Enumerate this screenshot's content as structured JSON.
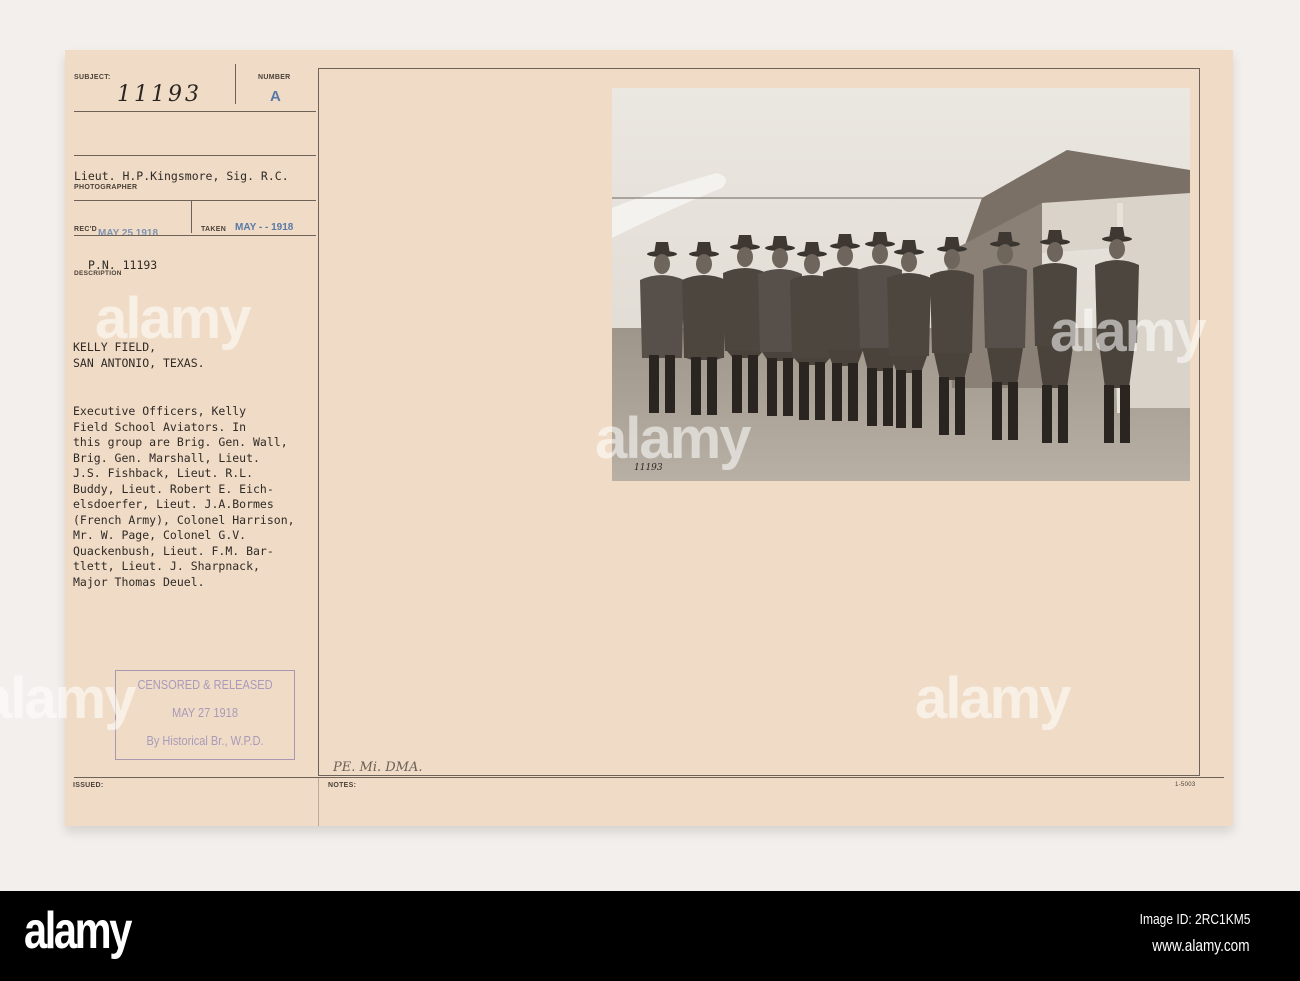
{
  "card": {
    "subject_label": "SUBJECT:",
    "subject_number": "11193",
    "number_label": "NUMBER",
    "number_value": "A",
    "photographer": "Lieut. H.P.Kingsmore, Sig. R.C.",
    "photographer_label": "PHOTOGRAPHER",
    "recd_label": "REC'D",
    "recd_date": "MAY 25 1918",
    "taken_label": "TAKEN",
    "taken_date": "MAY - - 1918",
    "pn": "P.N. 11193",
    "description_label": "DESCRIPTION",
    "location_line1": "KELLY FIELD,",
    "location_line2": "SAN ANTONIO, TEXAS.",
    "description_lines": [
      "Executive Officers, Kelly",
      "Field School Aviators. In",
      "this group are Brig. Gen. Wall,",
      "Brig. Gen. Marshall, Lieut.",
      "J.S. Fishback, Lieut. R.L.",
      "Buddy, Lieut. Robert E. Eich-",
      "elsdoerfer, Lieut. J.A.Bormes",
      "(French Army), Colonel Harrison,",
      "Mr. W. Page, Colonel G.V.",
      "Quackenbush, Lieut. F.M. Bar-",
      "tlett, Lieut. J. Sharpnack,",
      "Major Thomas Deuel."
    ],
    "stamp": {
      "line1": "CENSORED & RELEASED",
      "line2": "MAY 27 1918",
      "line3": "By Historical Br., W.P.D."
    },
    "issued_label": "ISSUED:",
    "notes_label": "NOTES:",
    "notes_handwritten": "PE. Mi. DMA.",
    "form_number": "1-5003",
    "photo_handwritten_number": "11193"
  },
  "watermark": "alamy",
  "footer": {
    "logo": "alamy",
    "image_id": "Image ID: 2RC1KM5",
    "website": "www.alamy.com"
  }
}
